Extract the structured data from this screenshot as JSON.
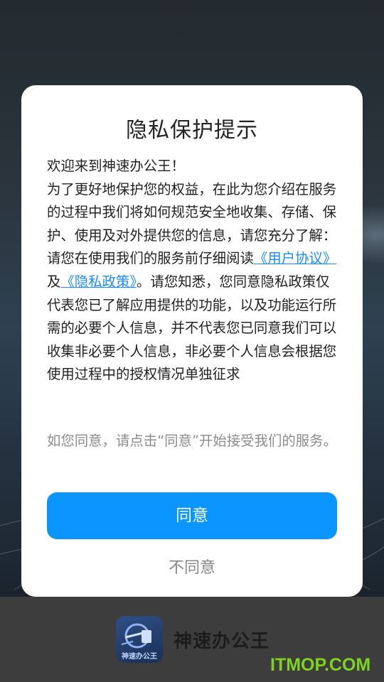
{
  "dialog": {
    "title": "隐私保护提示",
    "greeting": "欢迎来到神速办公王！",
    "intro": "为了更好地保护您的权益，在此为您介绍在服务的过程中我们将如何规范安全地收集、存储、保护、使用及对外提供您的信息，请您充分了解：",
    "read_prefix": "请您在使用我们的服务前仔细阅读",
    "user_agreement_link": "《用户协议》",
    "and_text": "及",
    "privacy_policy_link": "《隐私政策》",
    "read_suffix": "。请您知悉，您同意隐私政策仅代表您已了解应用提供的功能，以及功能运行所需的必要个人信息，并不代表您已同意我们可以收集非必要个人信息，非必要个人信息会根据您使用过程中的授权情况单独征求",
    "note": "如您同意，请点击“同意”开始接受我们的服务。",
    "agree_label": "同意",
    "disagree_label": "不同意"
  },
  "footer": {
    "app_name": "神速办公王",
    "logo_text": "神速办公王",
    "watermark": "ITMOP.COM"
  },
  "colors": {
    "accent": "#0a95ff",
    "link": "#1a8cff",
    "watermark": "#7ed321"
  },
  "icons": {
    "app_logo": "app-logo-icon"
  }
}
